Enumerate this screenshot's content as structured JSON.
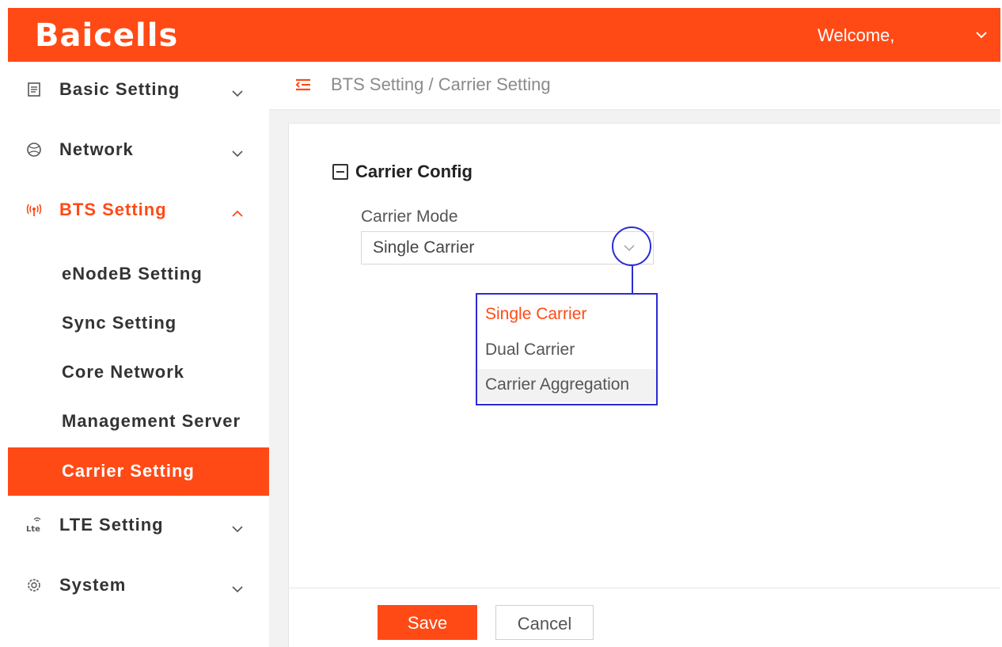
{
  "header": {
    "logo_text": "Baicells",
    "welcome_text": "Welcome,",
    "welcome_icon": "chevron-down-icon",
    "brand_color": "#ff4a16"
  },
  "sidebar": {
    "items": [
      {
        "label": "Basic Setting",
        "icon": "document-icon",
        "expanded": false
      },
      {
        "label": "Network",
        "icon": "globe-icon",
        "expanded": false
      },
      {
        "label": "BTS Setting",
        "icon": "antenna-icon",
        "expanded": true,
        "children": [
          {
            "label": "eNodeB Setting"
          },
          {
            "label": "Sync Setting"
          },
          {
            "label": "Core Network"
          },
          {
            "label": "Management Server"
          },
          {
            "label": "Carrier Setting",
            "selected": true
          }
        ]
      },
      {
        "label": "LTE Setting",
        "icon": "lte-icon",
        "expanded": false
      },
      {
        "label": "System",
        "icon": "gear-icon",
        "expanded": false
      }
    ]
  },
  "breadcrumb": {
    "icon": "menu-collapse-icon",
    "text": "BTS Setting / Carrier Setting"
  },
  "main": {
    "section_title": "Carrier Config",
    "carrier_mode": {
      "label": "Carrier Mode",
      "value": "Single Carrier",
      "options": [
        "Single Carrier",
        "Dual Carrier",
        "Carrier Aggregation"
      ],
      "selected_index": 0,
      "hover_index": 2
    },
    "buttons": {
      "save_label": "Save",
      "cancel_label": "Cancel"
    }
  },
  "annotation_color": "#2b2bd6"
}
